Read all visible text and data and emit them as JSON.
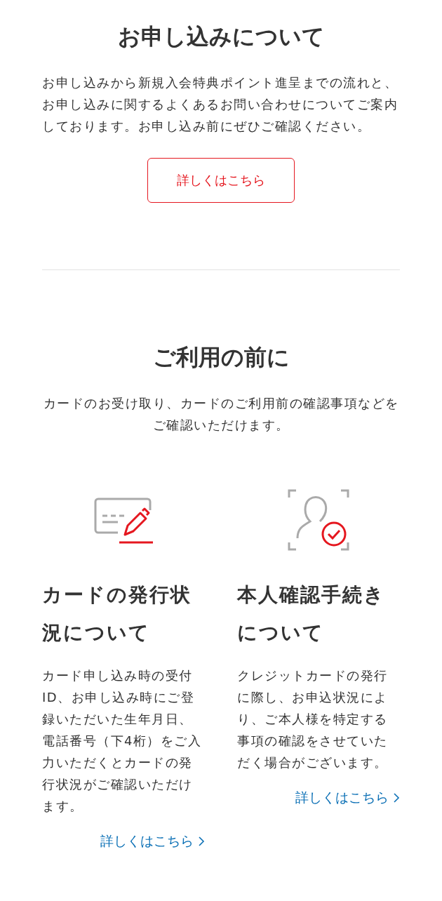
{
  "apply": {
    "title": "お申し込みについて",
    "description": "お申し込みから新規入会特典ポイント進呈までの流れと、お申し込みに関するよくあるお問い合わせについてご案内しております。お申し込み前にぜひご確認ください。",
    "button": "詳しくはこちら"
  },
  "before_use": {
    "title": "ご利用の前に",
    "description": "カードのお受け取り、カードのご利用前の確認事項などをご確認いただけます。",
    "cards": [
      {
        "kind": "card",
        "title": "カードの発行状況について",
        "text": "カード申し込み時の受付ID、お申し込み時にご登録いただいた生年月日、電話番号（下4桁）をご入力いただくとカードの発行状況がご確認いただけます。",
        "link": "詳しくはこちら"
      },
      {
        "kind": "identity",
        "title": "本人確認手続きについて",
        "text": "クレジットカードの発行に際し、お申込状況により、ご本人様を特定する事項の確認をさせていただく場合がございます。",
        "link": "詳しくはこちら"
      }
    ]
  }
}
